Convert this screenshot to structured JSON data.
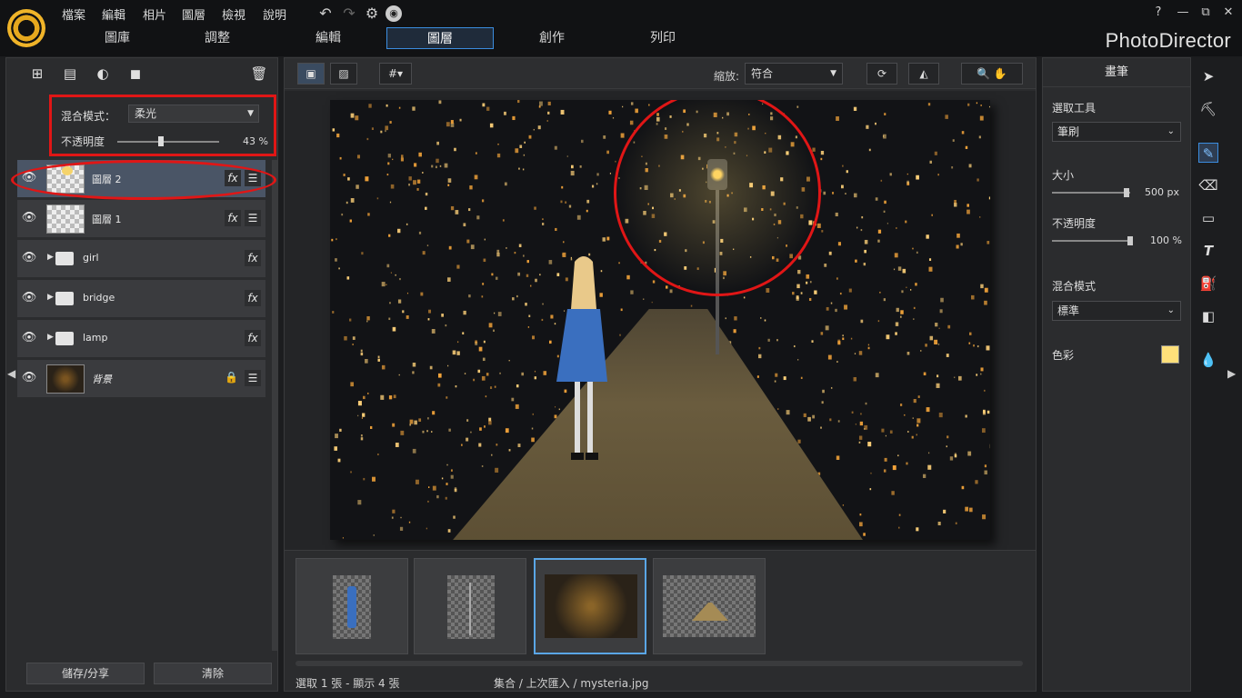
{
  "app": {
    "brand": "PhotoDirector"
  },
  "menu": {
    "items": [
      "檔案",
      "編輯",
      "相片",
      "圖層",
      "檢視",
      "說明"
    ]
  },
  "window": {
    "help": "?",
    "minimize": "—",
    "restore": "⧉",
    "close": "✕"
  },
  "tabs": [
    "圖庫",
    "調整",
    "編輯",
    "圖層",
    "創作",
    "列印"
  ],
  "active_tab": "圖層",
  "layers_panel": {
    "blend_label": "混合模式：",
    "blend_value": "柔光",
    "opacity_label": "不透明度",
    "opacity_value": "43 %",
    "opacity_fraction": 0.43,
    "layers": [
      {
        "name": "圖層 2",
        "fx": "fx",
        "adj": "☰"
      },
      {
        "name": "圖層 1",
        "fx": "fx",
        "adj": "☰"
      },
      {
        "name": "girl",
        "fx": "fx"
      },
      {
        "name": "bridge",
        "fx": "fx"
      },
      {
        "name": "lamp",
        "fx": "fx"
      },
      {
        "name": "背景",
        "lock": "🔒",
        "adj": "☰"
      }
    ],
    "save_share": "儲存/分享",
    "clear": "清除"
  },
  "canvas_toolbar": {
    "zoom_label": "縮放:",
    "zoom_value": "符合"
  },
  "status": {
    "selection": "選取 1 張 - 顯示 4 張",
    "path": "集合 / 上次匯入 / mysteria.jpg"
  },
  "brush_panel": {
    "title": "畫筆",
    "select_tool_label": "選取工具",
    "select_tool_value": "筆刷",
    "size_label": "大小",
    "size_value": "500 px",
    "size_fraction": 0.95,
    "opacity_label": "不透明度",
    "opacity_value": "100 %",
    "opacity_fraction": 1.0,
    "blend_label": "混合模式",
    "blend_value": "標準",
    "color_label": "色彩",
    "color": "#ffe07a"
  },
  "colors": {
    "accent": "#3b8de0",
    "highlight": "#e01616"
  }
}
